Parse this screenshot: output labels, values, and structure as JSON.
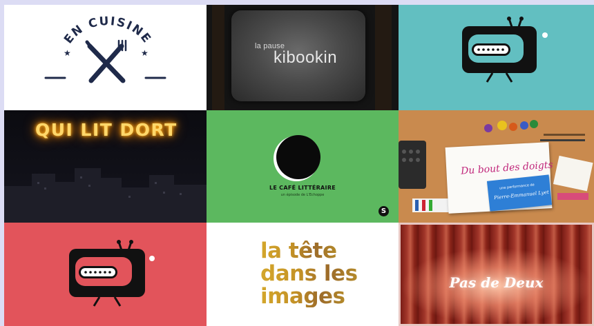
{
  "tiles": {
    "en_cuisine": {
      "title": "EN CUISINE"
    },
    "kibookin": {
      "small": "la pause",
      "big": "kibookin"
    },
    "qui_lit_dort": {
      "title": "QUI LIT DORT"
    },
    "cafe": {
      "label": "LE CAFÉ LITTÉRAIRE",
      "sub": "un épisode de L'Echoppe",
      "badge": "S"
    },
    "bout_des_doigts": {
      "script": "Du bout des doigts",
      "card_line1": "une performance de",
      "card_line2": "Pierre-Emmanuel Lyet"
    },
    "tete": {
      "line1": "la tête",
      "line2": "dans les",
      "line3": "images"
    },
    "pas_de_deux": {
      "title": "Pas de Deux"
    }
  },
  "colors": {
    "background": "#dcdcf4",
    "teal": "#62bfc1",
    "red": "#e2545b",
    "green": "#5cb85f",
    "navy": "#1f2a4a",
    "neon": "#ffd76a"
  },
  "icons": [
    "fork-knife-icon",
    "retro-tv-icon",
    "eclipse-icon"
  ]
}
